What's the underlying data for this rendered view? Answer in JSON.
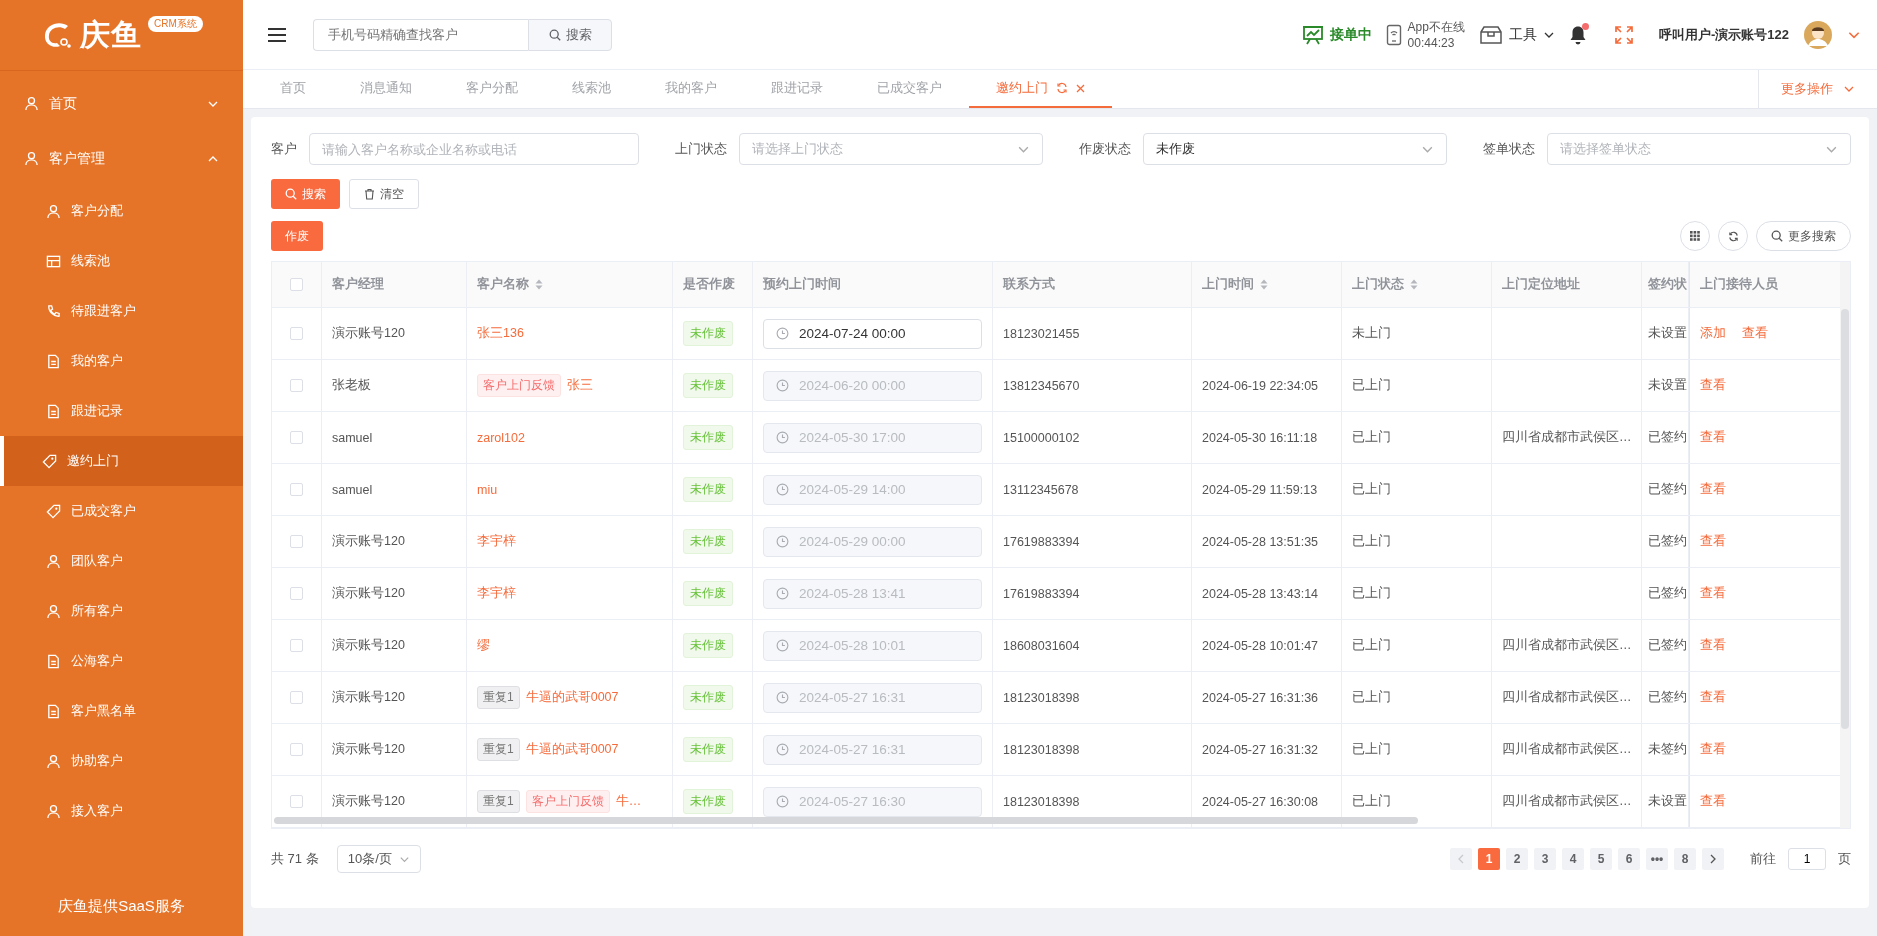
{
  "logo": {
    "name": "庆鱼",
    "badge": "CRM系统"
  },
  "sidebar": {
    "items": [
      {
        "label": "首页",
        "expanded": false
      },
      {
        "label": "客户管理",
        "expanded": true,
        "children": [
          {
            "label": "客户分配",
            "selected": false
          },
          {
            "label": "线索池",
            "selected": false
          },
          {
            "label": "待跟进客户",
            "selected": false
          },
          {
            "label": "我的客户",
            "selected": false
          },
          {
            "label": "跟进记录",
            "selected": false
          },
          {
            "label": "邀约上门",
            "selected": true
          },
          {
            "label": "已成交客户",
            "selected": false
          },
          {
            "label": "团队客户",
            "selected": false
          },
          {
            "label": "所有客户",
            "selected": false
          },
          {
            "label": "公海客户",
            "selected": false
          },
          {
            "label": "客户黑名单",
            "selected": false
          },
          {
            "label": "协助客户",
            "selected": false
          },
          {
            "label": "接入客户",
            "selected": false
          }
        ]
      }
    ],
    "footer": "庆鱼提供SaaS服务"
  },
  "header": {
    "search": {
      "placeholder": "手机号码精确查找客户",
      "button": "搜索"
    },
    "order_status": "接单中",
    "app_status": "App不在线",
    "app_timer": "00:44:23",
    "tools": "工具",
    "notification_dot": true,
    "user": "呼叫用户-演示账号122"
  },
  "tabs": [
    {
      "label": "首页",
      "selected": false
    },
    {
      "label": "消息通知",
      "selected": false
    },
    {
      "label": "客户分配",
      "selected": false
    },
    {
      "label": "线索池",
      "selected": false
    },
    {
      "label": "我的客户",
      "selected": false
    },
    {
      "label": "跟进记录",
      "selected": false
    },
    {
      "label": "已成交客户",
      "selected": false
    },
    {
      "label": "邀约上门",
      "selected": true
    }
  ],
  "more_actions": "更多操作",
  "filters": [
    {
      "label": "客户",
      "kind": "input",
      "placeholder": "请输入客户名称或企业名称或电话"
    },
    {
      "label": "上门状态",
      "kind": "select",
      "placeholder": "请选择上门状态"
    },
    {
      "label": "作废状态",
      "kind": "select",
      "value": "未作废"
    },
    {
      "label": "签单状态",
      "kind": "select",
      "placeholder": "请选择签单状态"
    }
  ],
  "filter_buttons": {
    "search": "搜索",
    "clear": "清空"
  },
  "void_button": "作废",
  "more_search": "更多搜索",
  "table": {
    "select_all": {
      "checked": false
    },
    "columns": [
      {
        "label": "客户经理",
        "sortable": false
      },
      {
        "label": "客户名称",
        "sortable": true
      },
      {
        "label": "是否作废",
        "sortable": false
      },
      {
        "label": "预约上门时间",
        "sortable": false
      },
      {
        "label": "联系方式",
        "sortable": false
      },
      {
        "label": "上门时间",
        "sortable": true
      },
      {
        "label": "上门状态",
        "sortable": true
      },
      {
        "label": "上门定位地址",
        "sortable": false
      },
      {
        "label": "签约状",
        "sortable": false
      },
      {
        "label": "上门接待人员",
        "sortable": false
      }
    ],
    "rows": [
      {
        "checked": false,
        "manager": "演示账号120",
        "tags": [],
        "name": "张三136",
        "void_status": "未作废",
        "appointment": {
          "value": "2024-07-24 00:00",
          "disabled": false
        },
        "phone": "18123021455",
        "visit_time": "",
        "visit_status": "未上门",
        "address": "",
        "sign_status": "未设置",
        "actions": [
          "添加",
          "查看"
        ]
      },
      {
        "checked": false,
        "manager": "张老板",
        "tags": [
          {
            "kind": "feedback",
            "label": "客户上门反馈"
          }
        ],
        "name": "张三",
        "void_status": "未作废",
        "appointment": {
          "value": "2024-06-20 00:00",
          "disabled": true
        },
        "phone": "13812345670",
        "visit_time": "2024-06-19 22:34:05",
        "visit_status": "已上门",
        "address": "",
        "sign_status": "未设置",
        "actions": [
          "查看"
        ]
      },
      {
        "checked": false,
        "manager": "samuel",
        "tags": [],
        "name": "zarol102",
        "void_status": "未作废",
        "appointment": {
          "value": "2024-05-30 17:00",
          "disabled": true
        },
        "phone": "15100000102",
        "visit_time": "2024-05-30 16:11:18",
        "visit_status": "已上门",
        "address": "四川省成都市武侯区…",
        "sign_status": "已签约",
        "actions": [
          "查看"
        ]
      },
      {
        "checked": false,
        "manager": "samuel",
        "tags": [],
        "name": "miu",
        "void_status": "未作废",
        "appointment": {
          "value": "2024-05-29 14:00",
          "disabled": true
        },
        "phone": "13112345678",
        "visit_time": "2024-05-29 11:59:13",
        "visit_status": "已上门",
        "address": "",
        "sign_status": "已签约",
        "actions": [
          "查看"
        ]
      },
      {
        "checked": false,
        "manager": "演示账号120",
        "tags": [],
        "name": "李宇梓",
        "void_status": "未作废",
        "appointment": {
          "value": "2024-05-29 00:00",
          "disabled": true
        },
        "phone": "17619883394",
        "visit_time": "2024-05-28 13:51:35",
        "visit_status": "已上门",
        "address": "",
        "sign_status": "已签约",
        "actions": [
          "查看"
        ]
      },
      {
        "checked": false,
        "manager": "演示账号120",
        "tags": [],
        "name": "李宇梓",
        "void_status": "未作废",
        "appointment": {
          "value": "2024-05-28 13:41",
          "disabled": true
        },
        "phone": "17619883394",
        "visit_time": "2024-05-28 13:43:14",
        "visit_status": "已上门",
        "address": "",
        "sign_status": "已签约",
        "actions": [
          "查看"
        ]
      },
      {
        "checked": false,
        "manager": "演示账号120",
        "tags": [],
        "name": "缪",
        "void_status": "未作废",
        "appointment": {
          "value": "2024-05-28 10:01",
          "disabled": true
        },
        "phone": "18608031604",
        "visit_time": "2024-05-28 10:01:47",
        "visit_status": "已上门",
        "address": "四川省成都市武侯区…",
        "sign_status": "已签约",
        "actions": [
          "查看"
        ]
      },
      {
        "checked": false,
        "manager": "演示账号120",
        "tags": [
          {
            "kind": "duplicate",
            "label": "重复1"
          }
        ],
        "name": "牛逼的武哥0007",
        "void_status": "未作废",
        "appointment": {
          "value": "2024-05-27 16:31",
          "disabled": true
        },
        "phone": "18123018398",
        "visit_time": "2024-05-27 16:31:36",
        "visit_status": "已上门",
        "address": "四川省成都市武侯区…",
        "sign_status": "已签约",
        "actions": [
          "查看"
        ]
      },
      {
        "checked": false,
        "manager": "演示账号120",
        "tags": [
          {
            "kind": "duplicate",
            "label": "重复1"
          }
        ],
        "name": "牛逼的武哥0007",
        "void_status": "未作废",
        "appointment": {
          "value": "2024-05-27 16:31",
          "disabled": true
        },
        "phone": "18123018398",
        "visit_time": "2024-05-27 16:31:32",
        "visit_status": "已上门",
        "address": "四川省成都市武侯区…",
        "sign_status": "未签约",
        "actions": [
          "查看"
        ]
      },
      {
        "checked": false,
        "manager": "演示账号120",
        "tags": [
          {
            "kind": "duplicate",
            "label": "重复1"
          },
          {
            "kind": "feedback",
            "label": "客户上门反馈"
          }
        ],
        "name": "牛…",
        "void_status": "未作废",
        "appointment": {
          "value": "2024-05-27 16:30",
          "disabled": true
        },
        "phone": "18123018398",
        "visit_time": "2024-05-27 16:30:08",
        "visit_status": "已上门",
        "address": "四川省成都市武侯区…",
        "sign_status": "未设置",
        "actions": [
          "查看"
        ]
      }
    ]
  },
  "pagination": {
    "total": "共 71 条",
    "page_size": "10条/页",
    "pages": [
      {
        "label": "1",
        "selected": true
      },
      {
        "label": "2",
        "selected": false
      },
      {
        "label": "3",
        "selected": false
      },
      {
        "label": "4",
        "selected": false
      },
      {
        "label": "5",
        "selected": false
      },
      {
        "label": "6",
        "selected": false
      },
      {
        "label": "•••",
        "selected": false
      },
      {
        "label": "8",
        "selected": false
      }
    ],
    "goto_label": "前往",
    "goto_value": "1",
    "goto_suffix": "页"
  }
}
